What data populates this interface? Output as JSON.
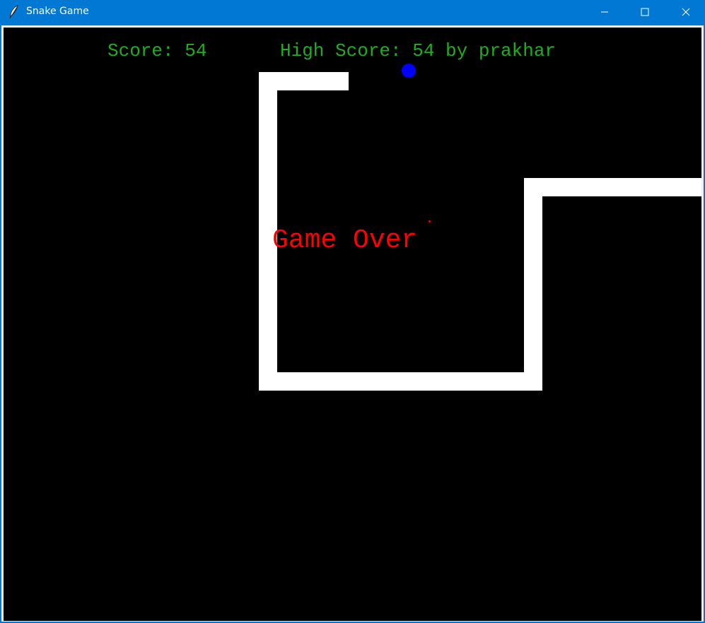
{
  "window": {
    "title": "Snake Game",
    "icon": "feather-icon",
    "controls": {
      "minimize_icon": "minimize-icon",
      "maximize_icon": "maximize-icon",
      "close_icon": "close-icon"
    }
  },
  "hud": {
    "score_label": "Score:",
    "score": "54",
    "high_score_label": "High Score:",
    "high_score": "54",
    "by_label": "by",
    "high_score_player": "prakhar",
    "score_text": "Score: 54",
    "high_score_text": "High Score: 54 by prakhar"
  },
  "game": {
    "status_text": "Game Over",
    "status_color": "#ff0000",
    "food_color": "#0000ff",
    "snake_color": "#ffffff",
    "background_color": "#000000",
    "hud_color": "#1fae1f"
  }
}
